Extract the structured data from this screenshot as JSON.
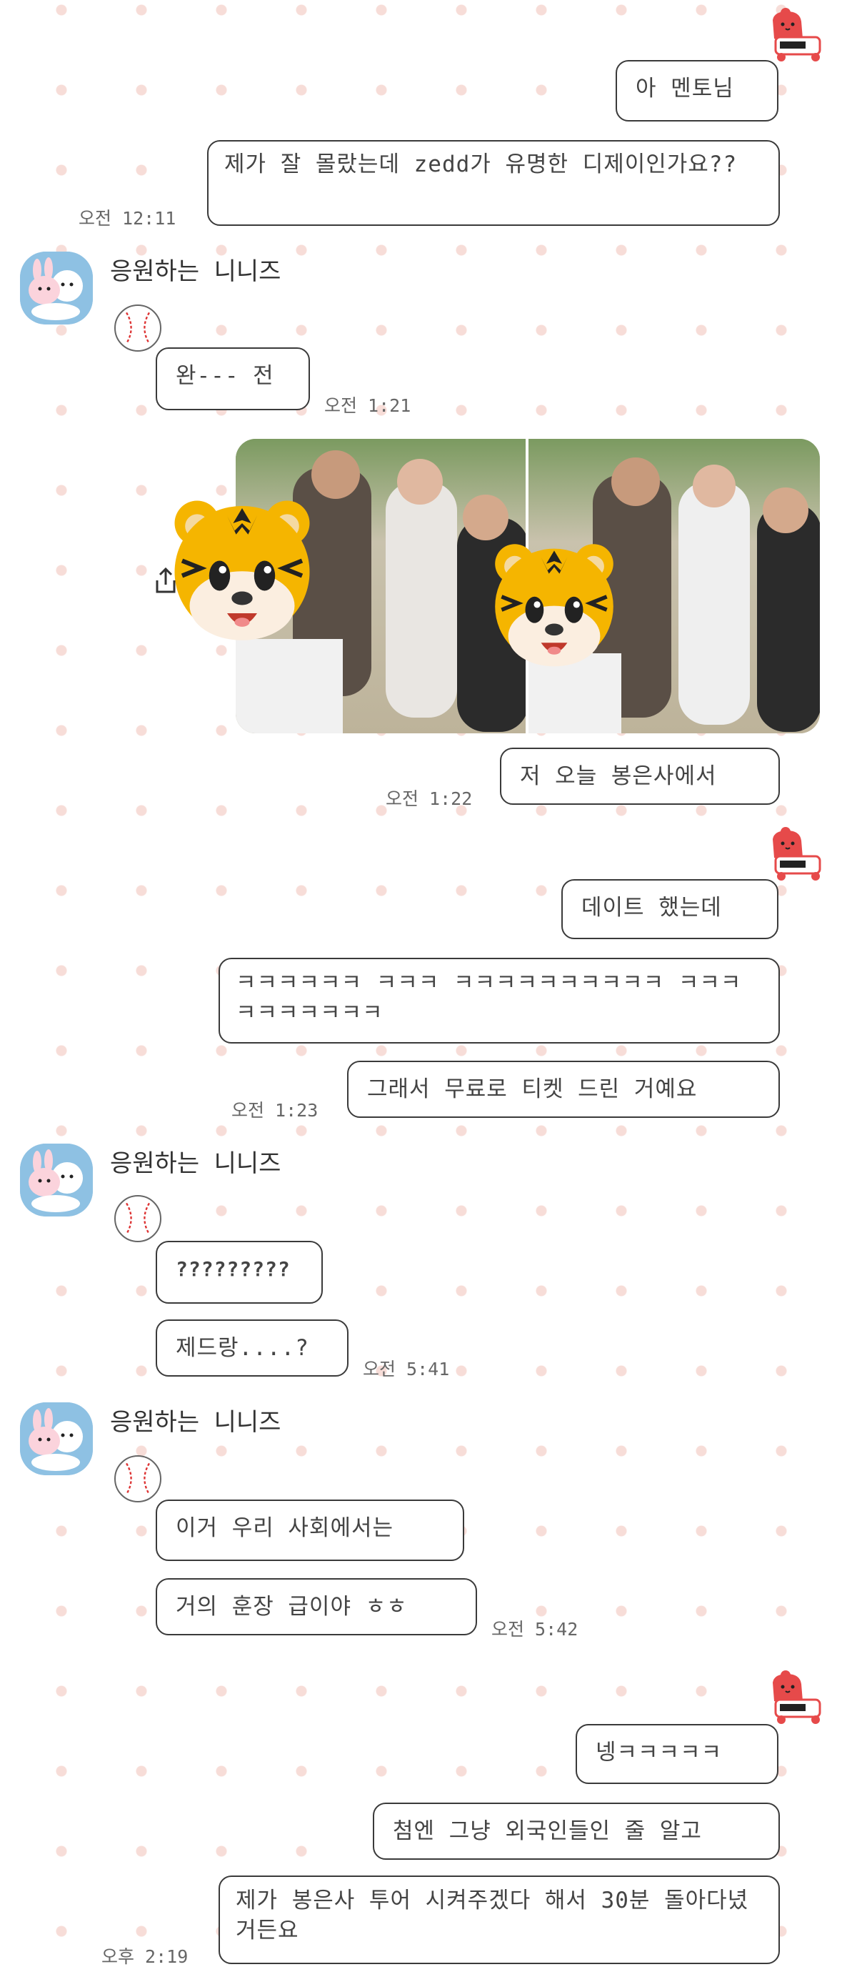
{
  "messages": {
    "m1": "아 멘토님",
    "m2": "제가 잘 몰랐는데 zedd가 유명한 디제이인가요??",
    "t1": "오전 12:11",
    "name1": "응원하는 니니즈",
    "m3": "완--- 전",
    "t2": "오전 1:21",
    "m4": "저 오늘 봉은사에서",
    "t3": "오전 1:22",
    "m5": "데이트 했는데",
    "m6": "ㅋㅋㅋㅋㅋㅋ ㅋㅋㅋ ㅋㅋㅋㅋㅋㅋㅋㅋㅋㅋ ㅋㅋㅋ ㅋㅋㅋㅋㅋㅋㅋ",
    "m7": "그래서 무료로 티켓 드린 거예요",
    "t4": "오전 1:23",
    "name2": "응원하는 니니즈",
    "m8": "?????????",
    "m9": "제드랑....?",
    "t5": "오전 5:41",
    "name3": "응원하는 니니즈",
    "m10": "이거 우리 사회에서는",
    "m11": "거의 훈장 급이야 ㅎㅎ",
    "t6": "오전 5:42",
    "m12": "넹ㅋㅋㅋㅋㅋ",
    "m13": "첨엔 그냥 외국인들인 줄 알고",
    "m14": "제가 봉은사 투어 시켜주겠다 해서 30분 돌아다녔거든요",
    "t7": "오후 2:19"
  },
  "icons": {
    "my_sticker": "red-bear-sticker-icon",
    "avatar": "ninizz-friends-avatar",
    "ball": "baseball-icon",
    "share": "share-icon",
    "face_cover": "tiger-emoji-icon"
  },
  "colors": {
    "background_dot": "#f7ddd8",
    "bubble_border": "#3a3a3a",
    "avatar_bg": "#8ec1e3",
    "sticker_red": "#e64a4a"
  }
}
